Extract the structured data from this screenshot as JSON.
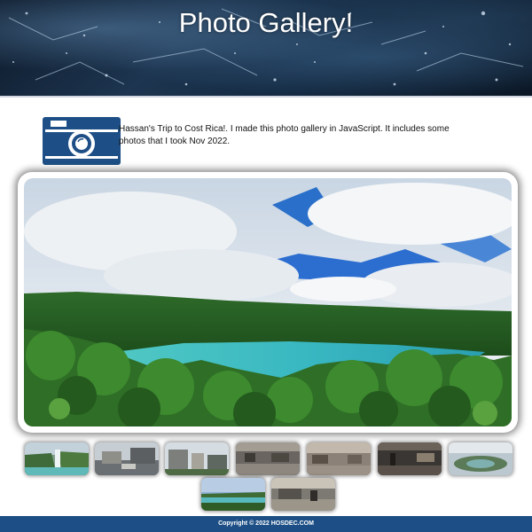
{
  "header": {
    "title": "Photo Gallery!"
  },
  "intro": {
    "icon": "camera-icon",
    "text": "Hassan's Trip to Cost Rica!. I made this photo gallery in JavaScript. It includes some photos that I took Nov 2022."
  },
  "main_photo": {
    "subject": "crater-lake"
  },
  "thumbnails": [
    {
      "subject": "waterfall"
    },
    {
      "subject": "street"
    },
    {
      "subject": "buildings"
    },
    {
      "subject": "interior-hall"
    },
    {
      "subject": "interior-lobby"
    },
    {
      "subject": "interior-dark"
    },
    {
      "subject": "crater-aerial"
    },
    {
      "subject": "lake"
    },
    {
      "subject": "terminal"
    }
  ],
  "footer": {
    "text": "Copyright © 2022 HOSDEC.COM"
  },
  "colors": {
    "footer": "#1d4f86",
    "camera": "#1d4f86",
    "header_dark": "#0d1a2a"
  }
}
